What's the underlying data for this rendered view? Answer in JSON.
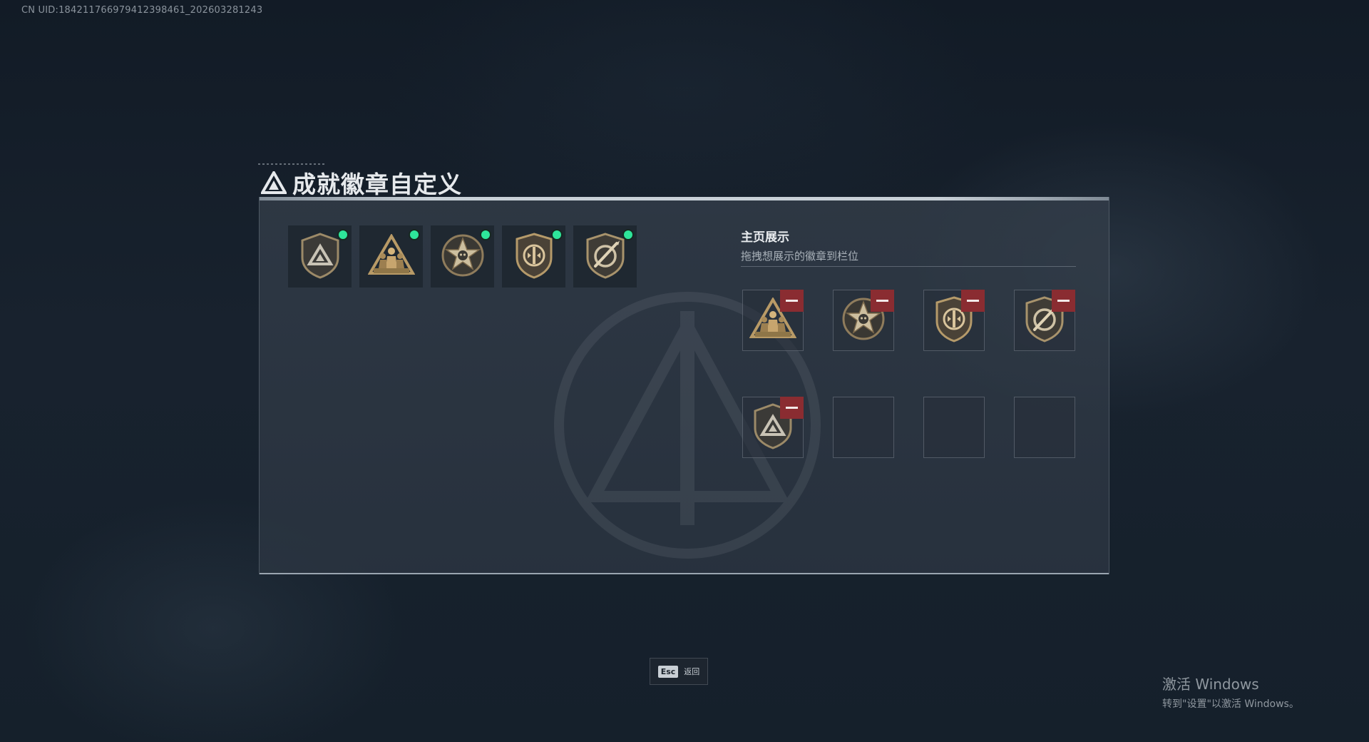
{
  "uid_text": "CN UID:18421176697941239846​1_202603281243",
  "title": "成就徽章自定义",
  "inventory": {
    "badges": [
      {
        "icon": "shield-triangle-badge-icon",
        "equipped": true
      },
      {
        "icon": "soldiers-triangle-badge-icon",
        "equipped": true
      },
      {
        "icon": "star-skull-badge-icon",
        "equipped": true
      },
      {
        "icon": "round-shield-badge-icon",
        "equipped": true
      },
      {
        "icon": "sword-shield-badge-icon",
        "equipped": true
      }
    ]
  },
  "display": {
    "title": "主页展示",
    "subtitle": "拖拽想展示的徽章到栏位",
    "slots": [
      {
        "icon": "soldiers-triangle-badge-icon",
        "filled": true
      },
      {
        "icon": "star-skull-badge-icon",
        "filled": true
      },
      {
        "icon": "round-shield-badge-icon",
        "filled": true
      },
      {
        "icon": "sword-shield-badge-icon",
        "filled": true
      },
      {
        "icon": "shield-triangle-badge-icon",
        "filled": true
      },
      {
        "filled": false
      },
      {
        "filled": false
      },
      {
        "filled": false
      }
    ]
  },
  "footer": {
    "esc_key": "Esc",
    "esc_label": "返回"
  },
  "windows_watermark": {
    "line1": "激活 Windows",
    "line2": "转到\"设置\"以激活 Windows。"
  },
  "colors": {
    "equipped_dot": "#2ee59a",
    "remove_button": "#8a2c31",
    "badge_gold": "#b89a66"
  }
}
